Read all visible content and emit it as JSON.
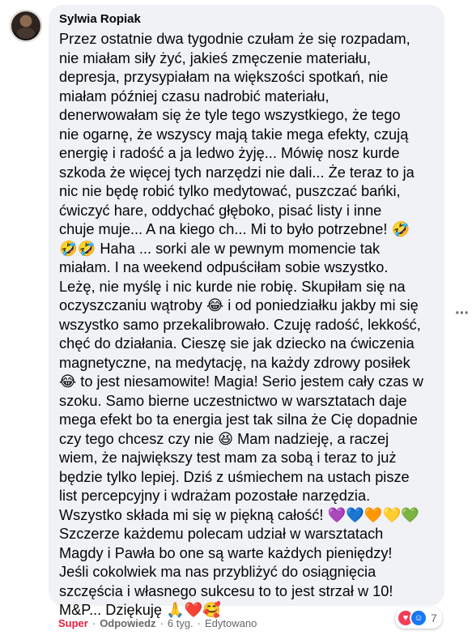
{
  "comment": {
    "author": "Sylwia Ropiak",
    "lines": [
      "Przez ostatnie dwa tygodnie czułam że się rozpadam,",
      "nie miałam siły żyć, jakieś zmęczenie materiału,",
      "depresja, przysypiałam na większości spotkań, nie",
      "miałam później czasu nadrobić materiału,",
      "denerwowałam się że tyle tego wszystkiego, że tego",
      "nie ogarnę, że wszyscy mają takie mega efekty, czują",
      "energię i radość a ja ledwo żyję... Mówię nosz kurde",
      "szkoda że więcej tych narzędzi nie dali... Że teraz to ja",
      "nic nie będę robić tylko medytować, puszczać bańki,",
      "ćwiczyć hare, oddychać głęboko, pisać listy i inne",
      "chuje muje... A na kiego ch... Mi to było potrzebne! 🤣",
      "🤣🤣 Haha ... sorki ale w pewnym momencie tak",
      "miałam. I na weekend odpuściłam sobie wszystko.",
      "Leżę, nie myślę i nic kurde nie robię. Skupiłam się na",
      "oczyszczaniu wątroby 😂 i od poniedziałku jakby mi się",
      "wszystko samo przekalibrowało. Czuję radość, lekkość,",
      "chęć do działania. Cieszę sie jak dziecko na ćwiczenia",
      "magnetyczne, na medytację, na każdy zdrowy posiłek",
      "😂 to jest niesamowite! Magia! Serio jestem cały czas w",
      "szoku. Samo bierne uczestnictwo w warsztatach daje",
      "mega efekt bo ta energia jest tak silna że Cię dopadnie",
      "czy tego chcesz czy nie 😆 Mam nadzieję, a raczej",
      "wiem, że największy test mam za sobą i teraz to już",
      "będzie tylko lepiej. Dziś z uśmiechem na ustach pisze",
      "list percepcyjny i wdrażam pozostałe narzędzia.",
      "Wszystko składa mi się w piękną całość! 💜💙🧡💛💚",
      "Szczerze każdemu polecam udział w warsztatach",
      "Magdy i Pawła bo one są warte każdych pieniędzy!",
      "Jeśli cokolwiek ma nas przybliżyć do osiągnięcia",
      "szczęścia i własnego sukcesu to to jest strzał w 10!",
      "M&P... Dziękuję 🙏❤️🥰"
    ]
  },
  "reactions": {
    "count": "7",
    "types": [
      "love",
      "haha"
    ]
  },
  "actions": {
    "reaction_label": "Super",
    "reply_label": "Odpowiedz",
    "time": "6 tyg.",
    "edited": "Edytowano",
    "separator": "·"
  },
  "menu": {
    "more_label": "···"
  },
  "colors": {
    "bubble": "#f0f2f5",
    "super": "#e41e3f",
    "meta": "#65676b"
  }
}
